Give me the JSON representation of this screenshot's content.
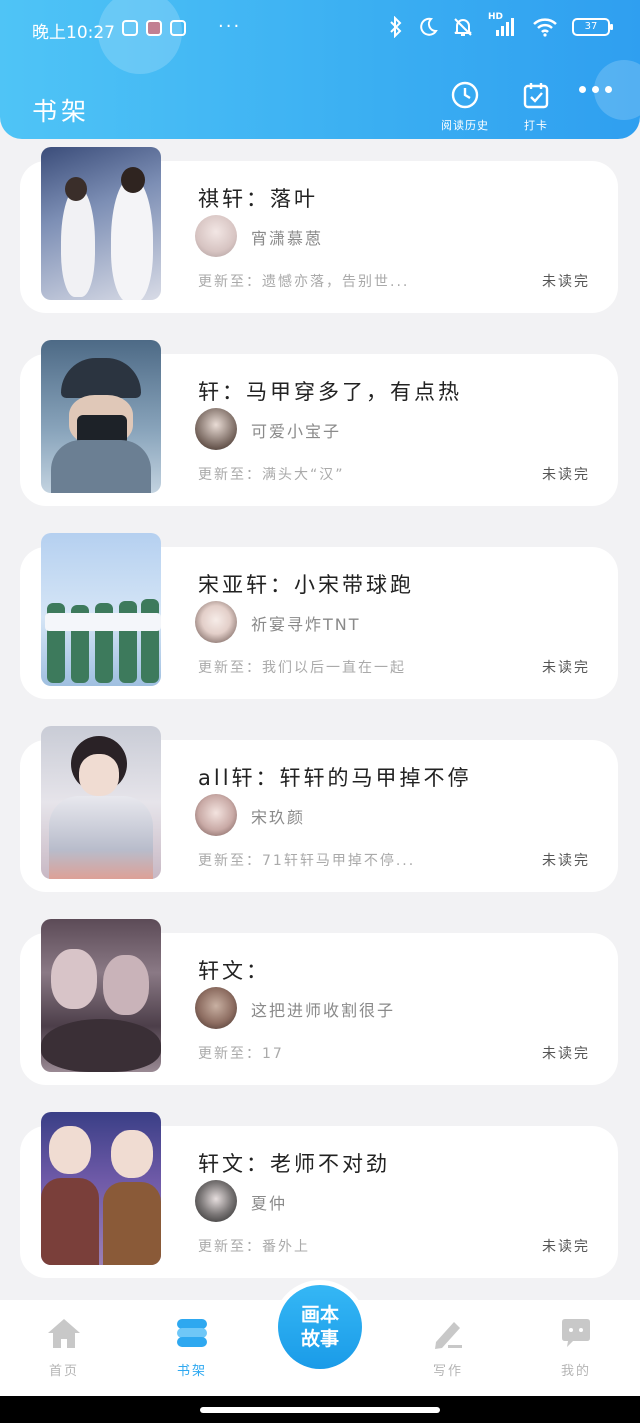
{
  "status_bar": {
    "time": "晚上10:27",
    "hd": "HD",
    "battery": "37",
    "more": "···"
  },
  "header": {
    "title": "书架",
    "history_label": "阅读历史",
    "checkin_label": "打卡",
    "accent": "#3aaef2"
  },
  "books": [
    {
      "title": "祺轩：落叶",
      "author": "宵潇慕蒽",
      "update": "更新至：遗憾亦落，告别世...",
      "status": "未读完"
    },
    {
      "title": "轩：马甲穿多了，有点热",
      "author": "可爱小宝子",
      "update": "更新至：满头大“汉”",
      "status": "未读完"
    },
    {
      "title": "宋亚轩：小宋带球跑",
      "author": "祈宴寻炸TNT",
      "update": "更新至：我们以后一直在一起",
      "status": "未读完"
    },
    {
      "title": "all轩：轩轩的马甲掉不停",
      "author": "宋玖颜",
      "update": "更新至：71轩轩马甲掉不停...",
      "status": "未读完"
    },
    {
      "title": "轩文：",
      "author": "这把进师收割很子",
      "update": "更新至：17",
      "status": "未读完"
    },
    {
      "title": "轩文：老师不对劲",
      "author": "夏仲",
      "update": "更新至：番外上",
      "status": "未读完"
    }
  ],
  "nav": {
    "home": "首页",
    "shelf": "书架",
    "center": "画本故事",
    "write": "写作",
    "mine": "我的",
    "active_color": "#2ea8f0",
    "inactive_color": "#c8c8c8"
  }
}
